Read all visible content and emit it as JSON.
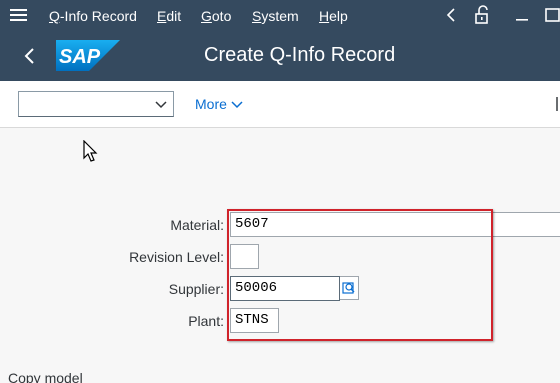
{
  "menubar": {
    "items": [
      {
        "label": "Q-Info Record",
        "underline": "Q",
        "rest": "-Info Record"
      },
      {
        "label": "Edit",
        "underline": "E",
        "rest": "dit"
      },
      {
        "label": "Goto",
        "underline": "G",
        "rest": "oto"
      },
      {
        "label": "System",
        "underline": "S",
        "rest": "ystem"
      },
      {
        "label": "Help",
        "underline": "H",
        "rest": "elp"
      }
    ]
  },
  "titlebar": {
    "logo_text": "SAP",
    "title": "Create Q-Info Record"
  },
  "toolbar": {
    "select_value": "",
    "more_label": "More"
  },
  "form": {
    "material": {
      "label": "Material:",
      "value": "5607"
    },
    "revision_level": {
      "label": "Revision Level:",
      "value": ""
    },
    "supplier": {
      "label": "Supplier:",
      "value": "50006"
    },
    "plant": {
      "label": "Plant:",
      "value": "STNS"
    }
  },
  "sections": {
    "copy_model": "Copy model"
  },
  "colors": {
    "shell_bar": "#354a5f",
    "link_blue": "#0a6ed1",
    "highlight_red": "#d0232b"
  },
  "icons": [
    "menu-icon",
    "back-icon",
    "unlock-icon",
    "minimize-icon",
    "maximize-icon",
    "chevron-down-icon",
    "value-help-icon"
  ]
}
